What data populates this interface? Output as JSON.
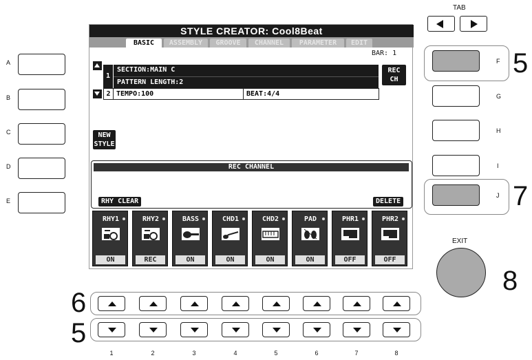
{
  "screen": {
    "title": "STYLE CREATOR: Cool8Beat",
    "tabs": [
      "BASIC",
      "ASSEMBLY",
      "GROOVE",
      "CHANNEL",
      "PARAMETER",
      "EDIT"
    ],
    "bar_label": "BAR:  1",
    "row1_num": "1",
    "section": "SECTION:MAIN C",
    "pattern_length": "PATTERN LENGTH:2",
    "row2_num": "2",
    "tempo": "TEMPO:100",
    "beat": "BEAT:4/4",
    "rec_ch_line1": "REC",
    "rec_ch_line2": "CH",
    "new_style_line1": "NEW",
    "new_style_line2": "STYLE",
    "rec_channel_header": "REC CHANNEL",
    "rhy_clear": "RHY CLEAR",
    "delete": "DELETE",
    "channels": [
      {
        "name": "RHY1",
        "status": "ON",
        "icon": "drum-kit-icon"
      },
      {
        "name": "RHY2",
        "status": "REC",
        "icon": "drum-kit-icon"
      },
      {
        "name": "BASS",
        "status": "ON",
        "icon": "bass-guitar-icon"
      },
      {
        "name": "CHD1",
        "status": "ON",
        "icon": "guitar-icon"
      },
      {
        "name": "CHD2",
        "status": "ON",
        "icon": "keyboard-icon"
      },
      {
        "name": "PAD",
        "status": "ON",
        "icon": "strings-icon"
      },
      {
        "name": "PHR1",
        "status": "OFF",
        "icon": "brass-icon"
      },
      {
        "name": "PHR2",
        "status": "OFF",
        "icon": "brass-icon"
      }
    ]
  },
  "left_buttons": [
    "A",
    "B",
    "C",
    "D",
    "E"
  ],
  "right_buttons": [
    "F",
    "G",
    "H",
    "I",
    "J"
  ],
  "tab_label": "TAB",
  "exit_label": "EXIT",
  "callouts": {
    "f": "5",
    "j": "7",
    "exit": "8",
    "upper_row": "6",
    "lower_row": "5"
  },
  "numbers": [
    "1",
    "2",
    "3",
    "4",
    "5",
    "6",
    "7",
    "8"
  ]
}
